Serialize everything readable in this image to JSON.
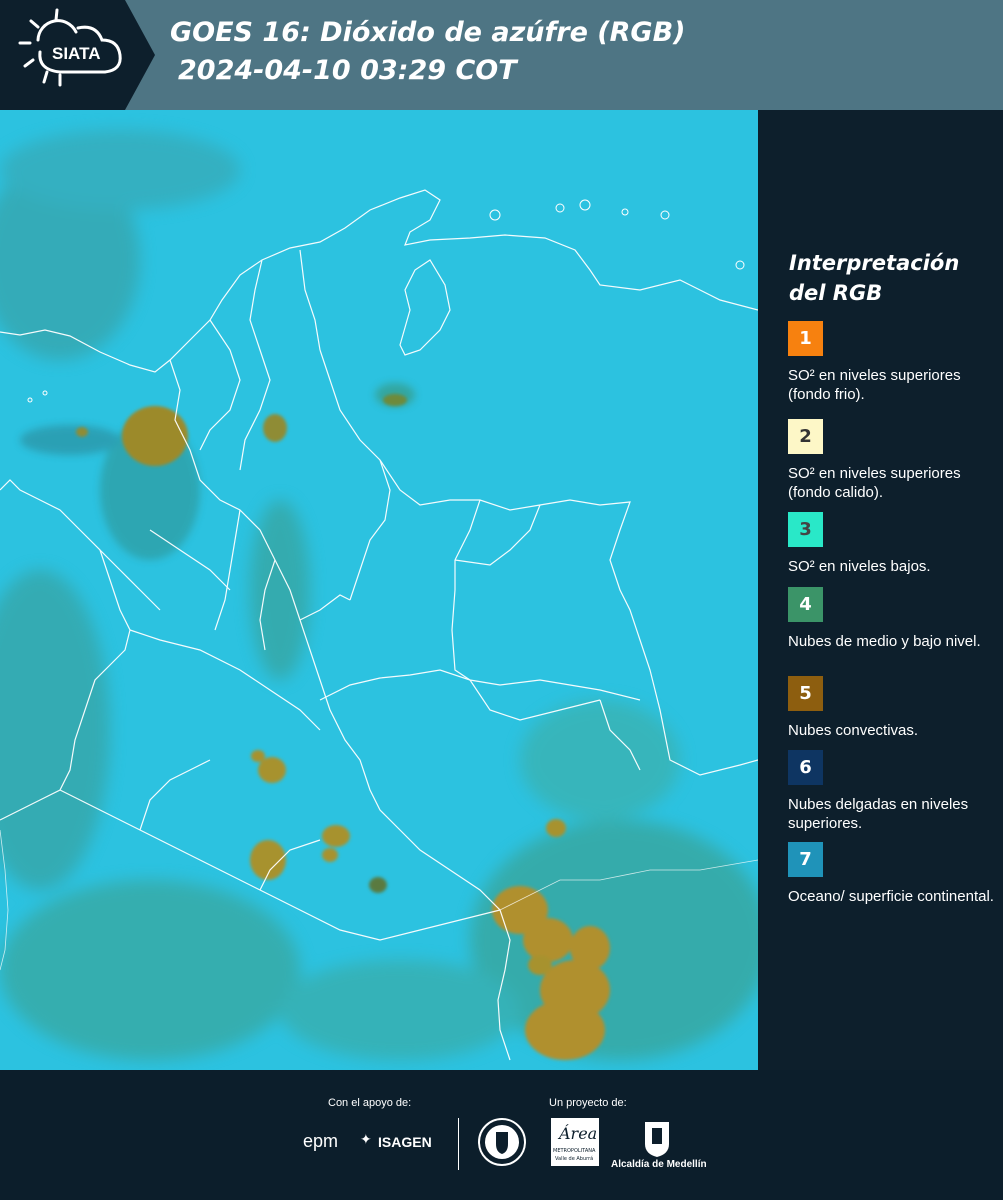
{
  "header": {
    "brand": "SIATA",
    "title_line1": "GOES 16: Dióxido de azúfre (RGB)",
    "title_line2": "2024-04-10 03:29 COT"
  },
  "legend": {
    "title_line1": "Interpretación",
    "title_line2": "del RGB",
    "items": [
      {
        "number": "1",
        "color": "#f7810f",
        "label": "SO² en niveles superiores (fondo frio)."
      },
      {
        "number": "2",
        "color": "#fdf7c7",
        "label": "SO² en niveles superiores (fondo calido)."
      },
      {
        "number": "3",
        "color": "#29e8c8",
        "label": "SO² en niveles bajos."
      },
      {
        "number": "4",
        "color": "#3b9468",
        "label": "Nubes de medio y bajo nivel."
      },
      {
        "number": "5",
        "color": "#8d5e0f",
        "label": "Nubes convectivas."
      },
      {
        "number": "6",
        "color": "#0e3562",
        "label": "Nubes delgadas en niveles superiores."
      },
      {
        "number": "7",
        "color": "#1f93b9",
        "label": "Oceano/ superficie continental."
      }
    ]
  },
  "footer": {
    "support_label": "Con el apoyo de:",
    "project_label": "Un proyecto de:",
    "sponsor_epm": "epm",
    "sponsor_isagen": "ISAGEN",
    "partner_area": "Área",
    "partner_area_sub": "METROPOLITANA",
    "partner_area_sub2": "Valle de Aburrá",
    "partner_alcaldia": "Alcaldía de Medellín",
    "partner_medellin": "MEDELLÍN"
  },
  "colors": {
    "header_bg": "#4e7584",
    "panel_bg": "#0d1f2c",
    "map_cyan": "#2bc3e1",
    "convective": "#9a8a2a"
  }
}
